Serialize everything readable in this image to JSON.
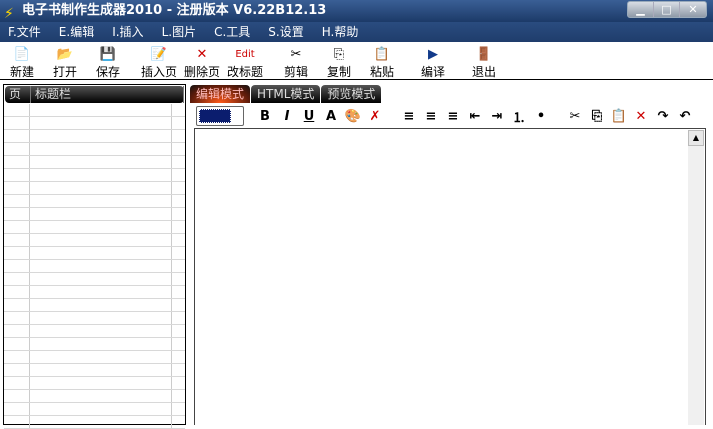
{
  "window": {
    "title": "电子书制作生成器2010 - 注册版本 V6.22B12.13",
    "icon": "lightning-icon"
  },
  "menu": [
    "F.文件",
    "E.编辑",
    "I.插入",
    "L.图片",
    "C.工具",
    "S.设置",
    "H.帮助"
  ],
  "toolbar": [
    {
      "label": "新建",
      "icon": "new-icon",
      "glyph": "📄"
    },
    {
      "label": "打开",
      "icon": "open-folder-icon",
      "glyph": "📂"
    },
    {
      "label": "保存",
      "icon": "save-icon",
      "glyph": "💾"
    },
    {
      "label": "插入页",
      "icon": "insert-page-icon",
      "glyph": "📝"
    },
    {
      "label": "删除页",
      "icon": "delete-icon",
      "glyph": "✕"
    },
    {
      "label": "改标题",
      "icon": "edit-title-icon",
      "glyph": "Edit"
    },
    {
      "label": "剪辑",
      "icon": "cut-icon",
      "glyph": "✂"
    },
    {
      "label": "复制",
      "icon": "copy-icon",
      "glyph": "⎘"
    },
    {
      "label": "粘贴",
      "icon": "paste-icon",
      "glyph": "📋"
    },
    {
      "label": "编译",
      "icon": "compile-icon",
      "glyph": "▶"
    },
    {
      "label": "退出",
      "icon": "exit-icon",
      "glyph": "🚪"
    }
  ],
  "left_panel": {
    "columns": [
      "页",
      "标题栏"
    ]
  },
  "tabs": [
    "编辑模式",
    "HTML模式",
    "预览模式"
  ],
  "editor_toolbar": {
    "color": "#0b1d6e",
    "buttons": [
      {
        "name": "bold",
        "g": "B"
      },
      {
        "name": "italic",
        "g": "I"
      },
      {
        "name": "underline",
        "g": "U"
      },
      {
        "name": "font-color",
        "g": "A"
      },
      {
        "name": "bg-color",
        "g": "🎨"
      },
      {
        "name": "clear-format",
        "g": "✗"
      },
      {
        "name": "align-left",
        "g": "≡"
      },
      {
        "name": "align-center",
        "g": "≡"
      },
      {
        "name": "align-right",
        "g": "≡"
      },
      {
        "name": "outdent",
        "g": "⇤"
      },
      {
        "name": "indent",
        "g": "⇥"
      },
      {
        "name": "ordered-list",
        "g": "⒈"
      },
      {
        "name": "bullet-list",
        "g": "•"
      },
      {
        "name": "cut",
        "g": "✂"
      },
      {
        "name": "copy",
        "g": "⎘"
      },
      {
        "name": "paste",
        "g": "📋"
      },
      {
        "name": "delete",
        "g": "✕"
      },
      {
        "name": "redo",
        "g": "↷"
      },
      {
        "name": "undo",
        "g": "↶"
      }
    ]
  }
}
